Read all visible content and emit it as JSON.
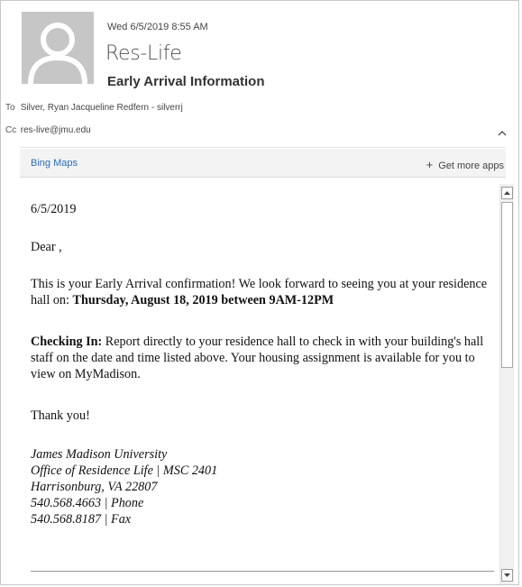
{
  "header": {
    "date": "Wed 6/5/2019 8:55 AM",
    "sender": "Res-Life",
    "subject": "Early Arrival Information",
    "to_label": "To",
    "to_value": "Silver, Ryan Jacqueline Redfern - silverrj",
    "cc_label": "Cc",
    "cc_value": "res-live@jmu.edu",
    "avatar_icon": "person-silhouette-icon",
    "collapse_icon": "chevron-up-icon"
  },
  "apps_bar": {
    "app_link": "Bing Maps",
    "more_apps_icon": "plus-icon",
    "more_apps_label": "Get more apps"
  },
  "message": {
    "date": "6/5/2019",
    "greeting": "Dear ,",
    "confirm_text": "This is your Early Arrival confirmation! We look forward to seeing you at your residence hall on: ",
    "confirm_bold": "Thursday, August 18, 2019 between 9AM-12PM",
    "checkin_label": "Checking In:",
    "checkin_text": " Report directly to your residence hall to check in with your building's hall staff on the date and time listed above. Your housing assignment is available for you to view on MyMadison.",
    "thanks": "Thank you!",
    "signature": [
      "James Madison University",
      "Office of Residence Life | MSC 2401",
      "Harrisonburg, VA 22807",
      "540.568.4663 | Phone",
      "540.568.8187 | Fax"
    ]
  },
  "scrollbar": {
    "up_icon": "scroll-up-arrow-icon",
    "down_icon": "scroll-down-arrow-icon"
  }
}
